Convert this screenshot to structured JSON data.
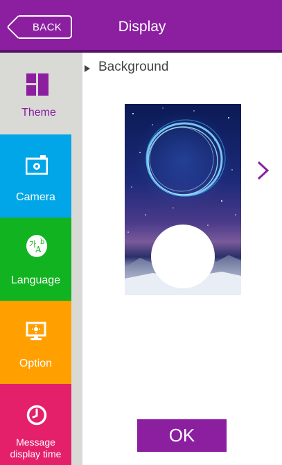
{
  "header": {
    "back_label": "BACK",
    "title": "Display"
  },
  "sidebar": {
    "tabs": [
      {
        "label": "Theme",
        "icon": "theme-icon",
        "color": "#d9d9d6",
        "selected": true
      },
      {
        "label": "Camera",
        "icon": "camera-icon",
        "color": "#00a6e8",
        "selected": false
      },
      {
        "label": "Language",
        "icon": "language-icon",
        "color": "#12b320",
        "selected": false
      },
      {
        "label": "Option",
        "icon": "option-icon",
        "color": "#ff9f00",
        "selected": false
      },
      {
        "label_line1": "Message",
        "label_line2": "display time",
        "icon": "clock-icon",
        "color": "#e4206a",
        "selected": false
      }
    ]
  },
  "main": {
    "section_title": "Background",
    "next_icon": "chevron-right-icon",
    "ok_label": "OK"
  },
  "colors": {
    "accent": "#8b1fa0",
    "accent_dark": "#5a0f6b"
  }
}
